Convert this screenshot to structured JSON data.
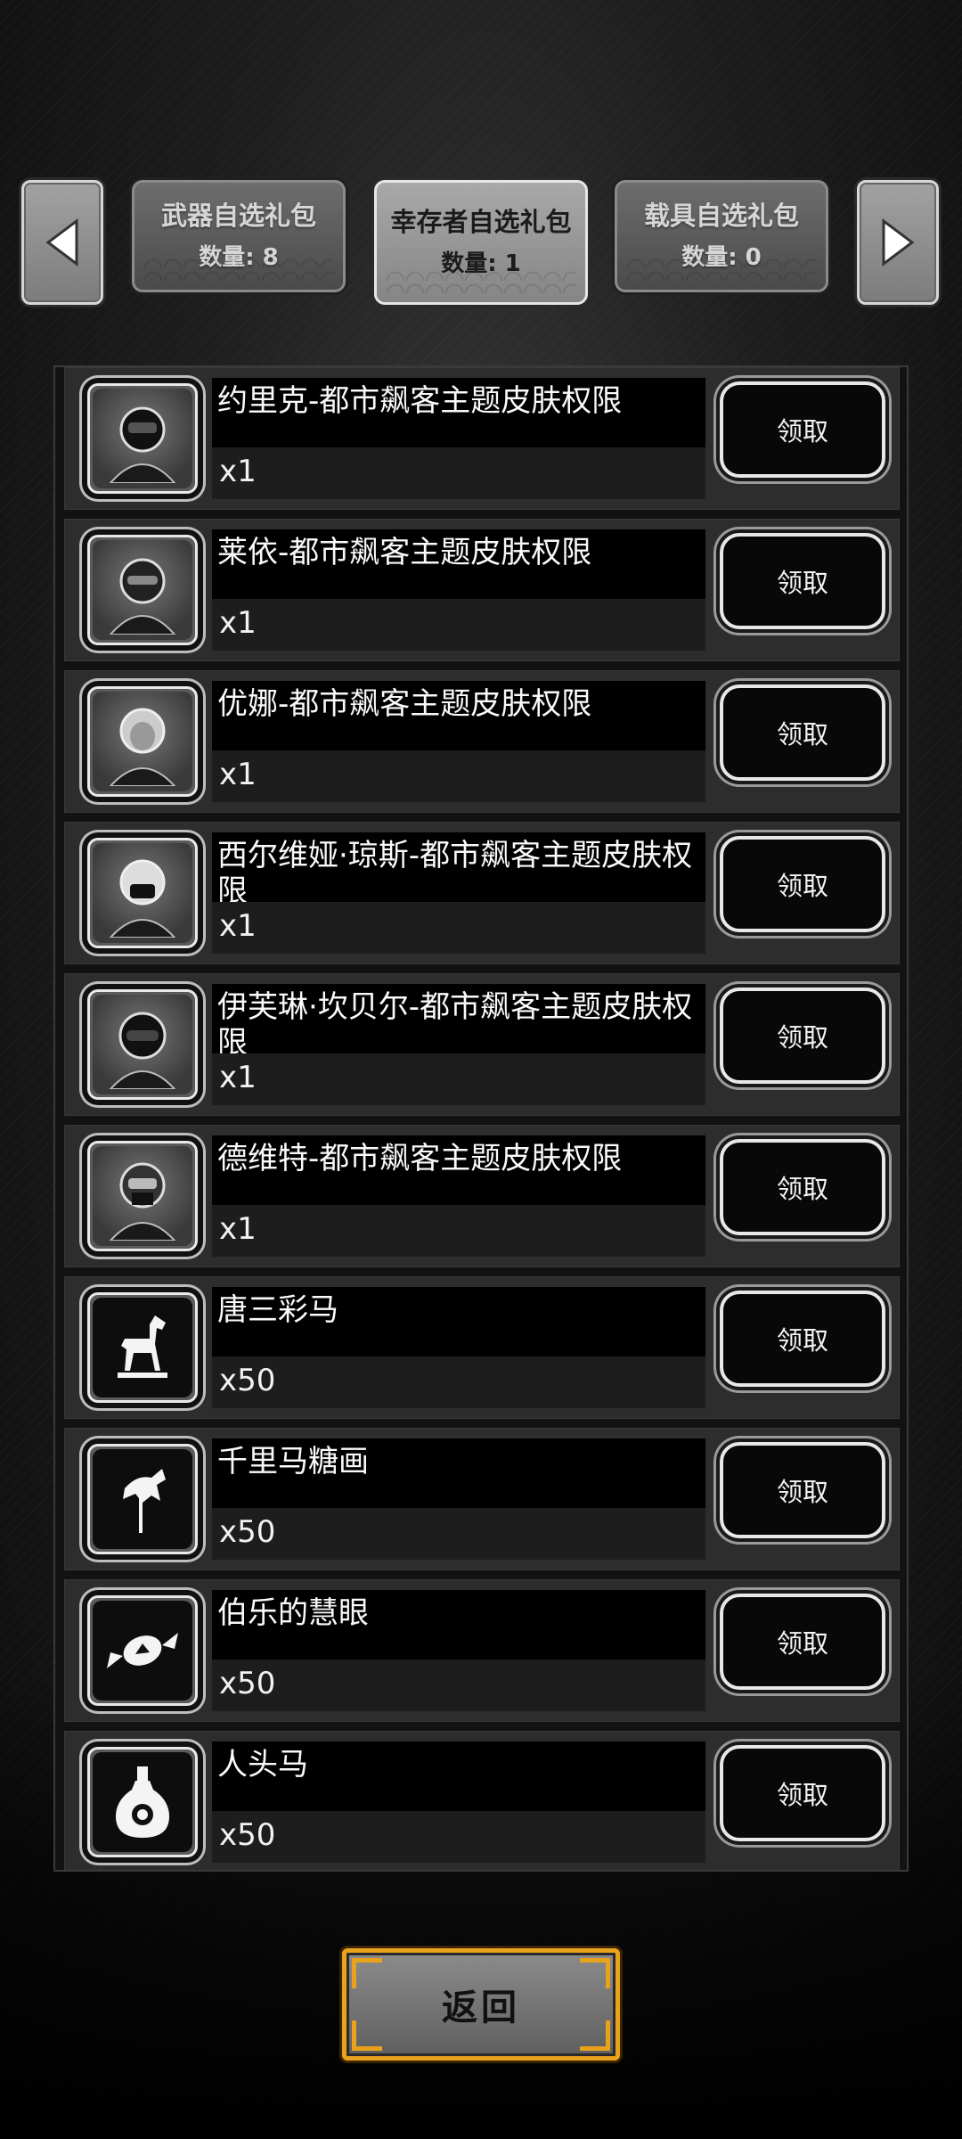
{
  "tabs": [
    {
      "title": "武器自选礼包",
      "count": "数量: 8",
      "state": "inactive"
    },
    {
      "title": "幸存者自选礼包",
      "count": "数量: 1",
      "state": "active"
    },
    {
      "title": "载具自选礼包",
      "count": "数量: 0",
      "state": "inactive"
    }
  ],
  "nav": {
    "left_icon": "triangle-left-icon",
    "right_icon": "triangle-right-icon"
  },
  "items": [
    {
      "name": "约里克-都市飙客主题皮肤权限",
      "qty": "x1",
      "icon": "helmet-portrait-icon",
      "claim": "领取"
    },
    {
      "name": "莱依-都市飙客主题皮肤权限",
      "qty": "x1",
      "icon": "helmet-portrait-icon",
      "claim": "领取"
    },
    {
      "name": "优娜-都市飙客主题皮肤权限",
      "qty": "x1",
      "icon": "helmet-portrait-icon",
      "claim": "领取"
    },
    {
      "name": "西尔维娅·琼斯-都市飙客主题皮肤权限",
      "qty": "x1",
      "icon": "helmet-portrait-icon",
      "claim": "领取"
    },
    {
      "name": "伊芙琳·坎贝尔-都市飙客主题皮肤权限",
      "qty": "x1",
      "icon": "helmet-portrait-icon",
      "claim": "领取"
    },
    {
      "name": "德维特-都市飙客主题皮肤权限",
      "qty": "x1",
      "icon": "helmet-portrait-icon",
      "claim": "领取"
    },
    {
      "name": "唐三彩马",
      "qty": "x50",
      "icon": "horse-statue-icon",
      "claim": "领取"
    },
    {
      "name": "千里马糖画",
      "qty": "x50",
      "icon": "sugar-horse-icon",
      "claim": "领取"
    },
    {
      "name": "伯乐的慧眼",
      "qty": "x50",
      "icon": "candy-icon",
      "claim": "领取"
    },
    {
      "name": "人头马",
      "qty": "x50",
      "icon": "bottle-icon",
      "claim": "领取"
    }
  ],
  "return_label": "返回",
  "colors": {
    "accent": "#e8a21c",
    "panel": "#2d2d2d",
    "button": "#080808"
  }
}
